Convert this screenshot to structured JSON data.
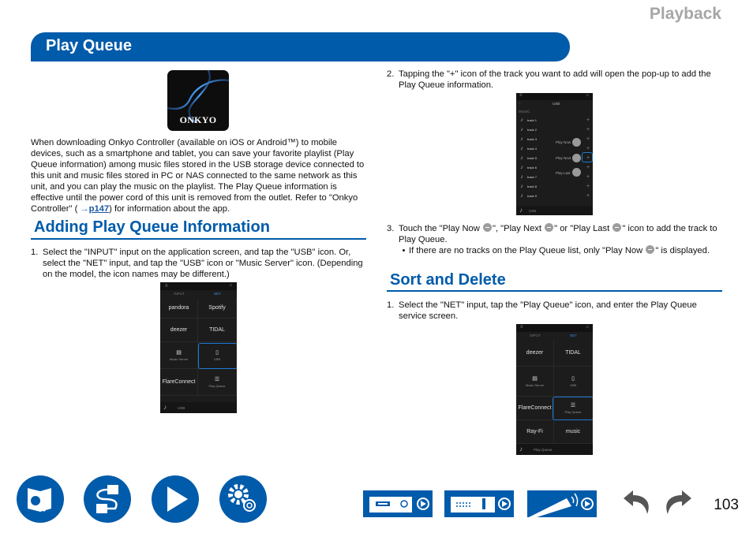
{
  "header": {
    "section": "Playback",
    "title": "Play Queue"
  },
  "app_icon": {
    "name": "onkyo-controller-app-icon",
    "label": "ONKYO"
  },
  "intro": {
    "text_before_link": "When downloading Onkyo Controller (available on iOS or Android™) to mobile devices, such as a smartphone and tablet, you can save your favorite playlist (Play Queue information) among music files stored in the USB storage device connected to this unit and music files stored in PC or NAS connected to the same network as this unit, and you can play the music on the playlist. The Play Queue information is effective until the power cord of this unit is removed from the outlet. Refer to \"Onkyo Controller\" ( ",
    "link_arrow": "→",
    "link_text": "p147",
    "text_after_link": ") for information about the app."
  },
  "adding": {
    "heading": "Adding Play Queue Information",
    "step1": {
      "num": "1.",
      "text": "Select the \"INPUT\" input on the application screen, and tap the \"USB\" icon. Or, select the \"NET\" input, and tap the \"USB\" icon or \"Music Server\" icon. (Depending on the model, the icon names may be different.)"
    },
    "step2": {
      "num": "2.",
      "text": "Tapping the \"+\" icon of the track you want to add will open the pop-up to add the Play Queue information."
    },
    "step3": {
      "num": "3.",
      "t1": "Touch the \"Play Now ",
      "t2": "\", \"Play Next ",
      "t3": "\" or \"Play Last ",
      "t4": "\" icon to add the track to Play Queue.",
      "bullet": {
        "dot": "•",
        "t1": "If there are no tracks on the Play Queue list, only \"Play Now ",
        "t2": "\" is displayed."
      }
    }
  },
  "sort": {
    "heading": "Sort and Delete",
    "step1": {
      "num": "1.",
      "text": "Select the \"NET\" input, tap the \"Play Queue\" icon, and enter the Play Queue service screen."
    }
  },
  "screen1": {
    "tabs": [
      "INPUT",
      "NET"
    ],
    "tiles": [
      "pandora",
      "Spotify",
      "deezer",
      "TIDAL",
      "Music Server",
      "USB",
      "FlareConnect",
      "Play Queue"
    ],
    "footer": "USB"
  },
  "screen2": {
    "title": "USB",
    "section": "MUSIC",
    "tracks": [
      "track 1",
      "track 2",
      "track 3",
      "track 4",
      "track 5",
      "track 6",
      "track 7",
      "track 8",
      "track 9"
    ],
    "popup": [
      "Play Now",
      "Play Next",
      "Play Last"
    ],
    "footer": "USB"
  },
  "screen3": {
    "tabs": [
      "INPUT",
      "NET"
    ],
    "tiles": [
      "deezer",
      "TIDAL",
      "Music Server",
      "USB",
      "FlareConnect",
      "Play Queue",
      "Ray-Fi",
      "music"
    ],
    "footer": "Play Queue"
  },
  "footer_nav": {
    "icons": [
      "contents-icon",
      "connections-icon",
      "playback-icon",
      "settings-icon"
    ],
    "buttons": [
      "front-panel-button",
      "rear-panel-button",
      "remote-button"
    ],
    "page_number": "103"
  }
}
